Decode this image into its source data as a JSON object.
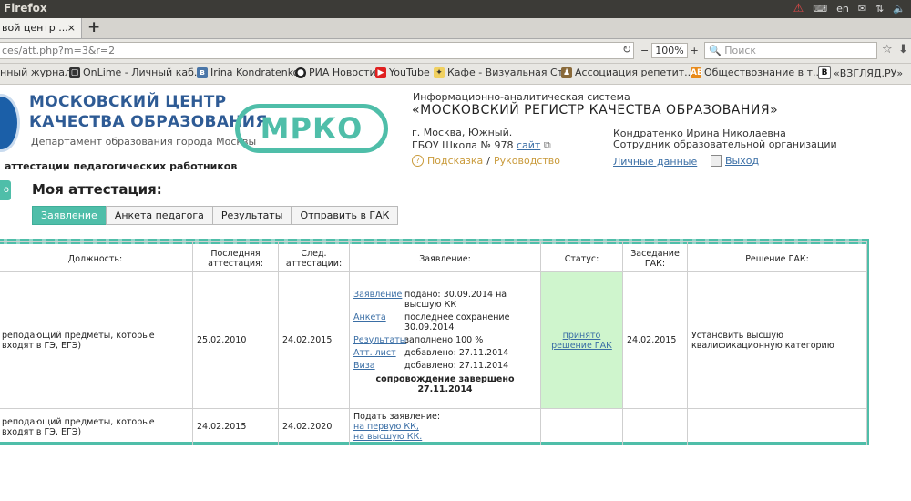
{
  "os": {
    "window_title": "Firefox",
    "lang": "en"
  },
  "browser": {
    "tab_title": "вой центр ...",
    "url": "ces/att.php?m=3&r=2",
    "zoom": "100%",
    "search_placeholder": "Поиск"
  },
  "bookmarks": [
    {
      "label": "нный журнал",
      "icon": "page-icon"
    },
    {
      "label": "OnLime - Личный каб...",
      "icon": "onlime-icon"
    },
    {
      "label": "Irina Kondratenko",
      "icon": "vk-icon"
    },
    {
      "label": "РИА Новости",
      "icon": "ria-icon"
    },
    {
      "label": "YouTube",
      "icon": "youtube-icon"
    },
    {
      "label": "Кафе - Визуальная Ст...",
      "icon": "cafe-icon"
    },
    {
      "label": "Ассоциация репетит...",
      "icon": "assoc-icon"
    },
    {
      "label": "Обществознание в т...",
      "icon": "ab-icon"
    },
    {
      "label": "«ВЗГЛЯД.РУ»",
      "icon": "vzglyad-icon"
    }
  ],
  "header": {
    "org_line1": "МОСКОВСКИЙ ЦЕНТР",
    "org_line2": "КАЧЕСТВА ОБРАЗОВАНИЯ",
    "dept": "Департамент образования города Москвы",
    "mrko": "МРКО",
    "sys_line1": "Информационно-аналитическая система",
    "sys_line2": "«МОСКОВСКИЙ РЕГИСТР КАЧЕСТВА ОБРАЗОВАНИЯ»",
    "city": "г. Москва, Южный.",
    "school": "ГБОУ Школа № 978",
    "site_link": "сайт",
    "help_link": "Подсказка",
    "separator": "/",
    "guide_link": "Руководство",
    "person": "Кондратенко Ирина Николаевна",
    "role": "Сотрудник образовательной организации",
    "personal_link": "Личные данные",
    "exit_link": "Выход",
    "section_title": "аттестации педагогических работников"
  },
  "page": {
    "side_button": "о",
    "title": "Моя аттестация:",
    "tabs": [
      {
        "label": "Заявление",
        "active": true
      },
      {
        "label": "Анкета педагога",
        "active": false
      },
      {
        "label": "Результаты",
        "active": false
      },
      {
        "label": "Отправить в ГАК",
        "active": false
      }
    ]
  },
  "table": {
    "headers": [
      "Должность:",
      "Последняя аттестация:",
      "След. аттестации:",
      "Заявление:",
      "Статус:",
      "Заседание ГАК:",
      "Решение ГАК:"
    ],
    "rows": [
      {
        "position": "реподающий предметы, которые входят в ГЭ, ЕГЭ)",
        "last": "25.02.2010",
        "next": "24.02.2015",
        "application": [
          {
            "label": "Заявление",
            "value": "подано: 30.09.2014 на высшую КК"
          },
          {
            "label": "Анкета",
            "value": "последнее сохранение 30.09.2014"
          },
          {
            "label": "Результаты",
            "value": "заполнено 100 %"
          },
          {
            "label": "Атт. лист",
            "value": "добавлено: 27.11.2014"
          },
          {
            "label": "Виза",
            "value": "добавлено: 27.11.2014"
          }
        ],
        "support_done": "сопровождение завершено 27.11.2014",
        "status": "принято решение ГАК",
        "meeting": "24.02.2015",
        "decision": "Установить высшую квалификационную категорию"
      },
      {
        "position": "реподающий предметы, которые входят в ГЭ, ЕГЭ)",
        "last": "24.02.2015",
        "next": "24.02.2020",
        "apply_label": "Подать заявление:",
        "apply_first": "на первую КК,",
        "apply_high": "на высшую КК.",
        "status": "",
        "meeting": "",
        "decision": ""
      }
    ]
  },
  "colors": {
    "accent": "#4fbea9",
    "brand_blue": "#2e5b95",
    "status_green": "#cff5cd",
    "link": "#3a6ea5"
  }
}
